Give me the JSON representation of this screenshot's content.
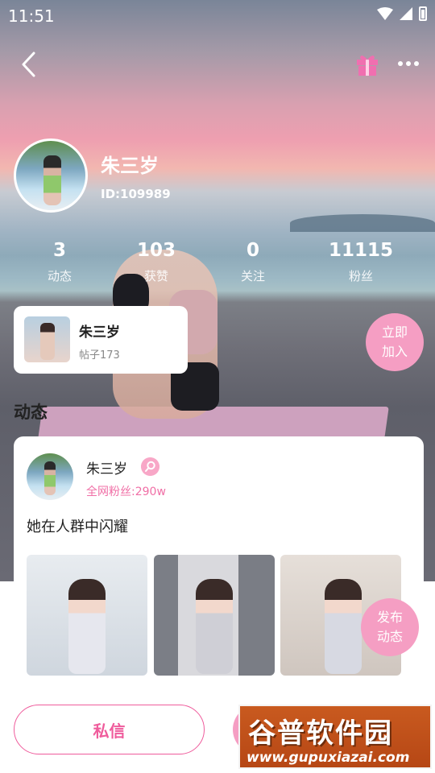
{
  "status_bar": {
    "time": "11:51"
  },
  "profile": {
    "name": "朱三岁",
    "id_text": "ID:109989"
  },
  "stats": [
    {
      "value": "3",
      "label": "动态"
    },
    {
      "value": "103",
      "label": "获赞"
    },
    {
      "value": "0",
      "label": "关注"
    },
    {
      "value": "11115",
      "label": "粉丝"
    }
  ],
  "circle_card": {
    "name": "朱三岁",
    "posts": "帖子173"
  },
  "join_button": {
    "line1": "立即",
    "line2": "加入"
  },
  "section": {
    "title": "动态"
  },
  "post": {
    "author": "朱三岁",
    "fans": "全网粉丝:290w",
    "text": "她在人群中闪耀"
  },
  "publish_button": {
    "line1": "发布",
    "line2": "动态"
  },
  "bottom": {
    "message_label": "私信"
  },
  "watermark": {
    "title": "谷普软件园",
    "url": "www.gupuxiazai.com"
  },
  "colors": {
    "accent": "#f59ec3",
    "accent_text": "#ef5c9c"
  },
  "icons": [
    "back-arrow-icon",
    "gift-icon",
    "more-dots-icon",
    "wifi-icon",
    "signal-icon",
    "battery-icon",
    "female-icon"
  ]
}
